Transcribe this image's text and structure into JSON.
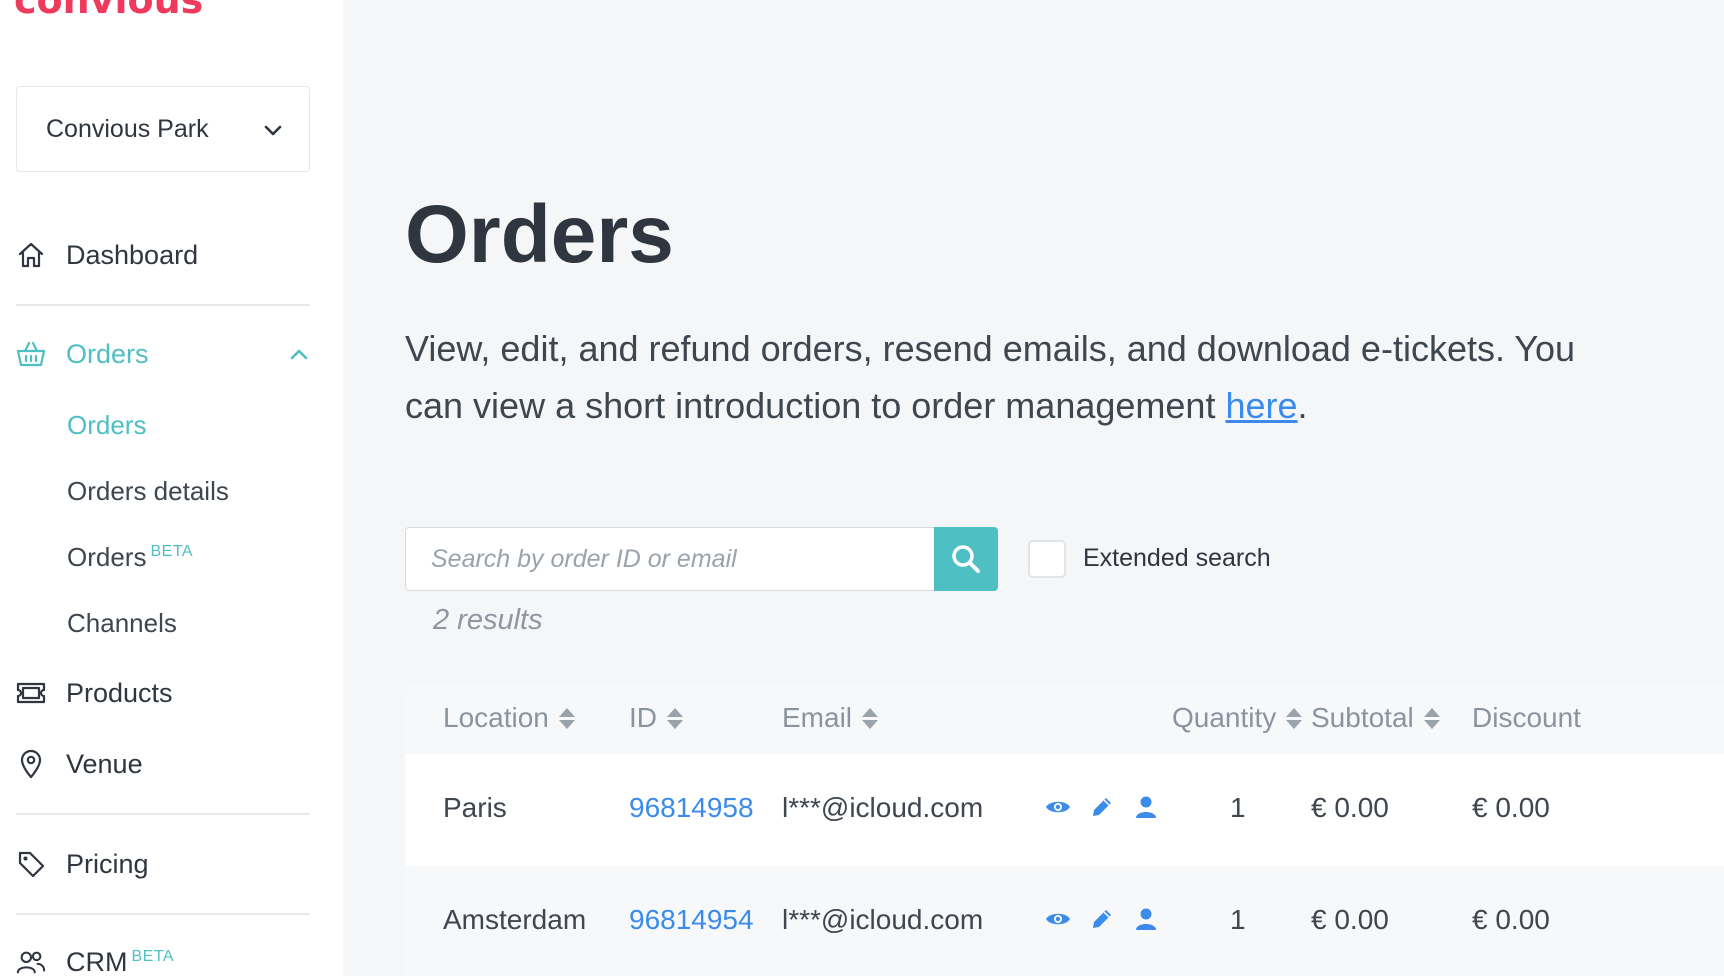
{
  "brand": {
    "logo_text": "convious",
    "accent": "#ef3a5d",
    "primary": "#4ebfc2",
    "link": "#3b8beb"
  },
  "sidebar": {
    "park_select": {
      "value": "Convious Park"
    },
    "nav": {
      "dashboard": "Dashboard",
      "orders": "Orders",
      "products": "Products",
      "venue": "Venue",
      "pricing": "Pricing",
      "crm": "CRM",
      "crm_badge": "BETA"
    },
    "orders_sub": {
      "orders": "Orders",
      "orders_details": "Orders details",
      "orders_beta": "Orders",
      "orders_beta_badge": "BETA",
      "channels": "Channels"
    }
  },
  "main": {
    "title": "Orders",
    "intro_text": "View, edit, and refund orders, resend emails, and download e-tickets. You can view a short introduction to order management ",
    "intro_link": "here",
    "intro_end": ".",
    "search": {
      "placeholder": "Search by order ID or email",
      "value": ""
    },
    "extended_search_label": "Extended search",
    "results_text": "2 results"
  },
  "table": {
    "headers": {
      "location": "Location",
      "id": "ID",
      "email": "Email",
      "quantity": "Quantity",
      "subtotal": "Subtotal",
      "discount": "Discount"
    },
    "rows": [
      {
        "location": "Paris",
        "id": "96814958",
        "email": "l***@icloud.com",
        "quantity": "1",
        "subtotal": "€ 0.00",
        "discount": "€ 0.00"
      },
      {
        "location": "Amsterdam",
        "id": "96814954",
        "email": "l***@icloud.com",
        "quantity": "1",
        "subtotal": "€ 0.00",
        "discount": "€ 0.00"
      }
    ],
    "row_actions": [
      "eye-icon",
      "pencil-icon",
      "user-icon"
    ]
  }
}
